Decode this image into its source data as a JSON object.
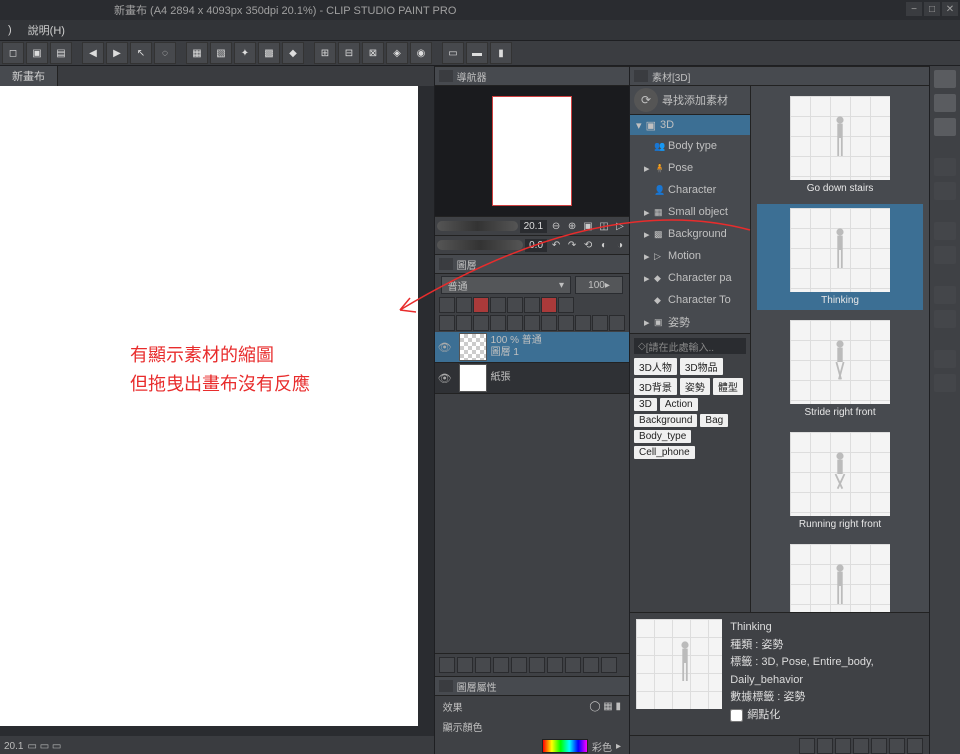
{
  "title": "新畫布 (A4 2894 x 4093px 350dpi 20.1%)  - CLIP STUDIO PAINT PRO",
  "menubar": {
    "item0": ")",
    "item1": "說明(H)"
  },
  "doc_tabs": {
    "0": "新畫布"
  },
  "statusbar": {
    "zoom": "20.1"
  },
  "annotation": {
    "line1": "有顯示素材的縮圖",
    "line2": "但拖曳出畫布沒有反應"
  },
  "navigator": {
    "title": "導航器",
    "zoom": "20.1",
    "angle": "0.0"
  },
  "layers": {
    "title": "圖層",
    "blend_mode": "普通",
    "opacity": "100",
    "items": [
      {
        "percent": "100 % 普通",
        "name": "圖層 1"
      },
      {
        "percent": "",
        "name": "紙張"
      }
    ]
  },
  "layer_props": {
    "title": "圖層屬性",
    "effect": "效果",
    "display_color": "顯示顏色",
    "color_mode": "彩色"
  },
  "materials": {
    "panel_title": "素材[3D]",
    "find_label": "尋找添加素材",
    "tree_root": "3D",
    "tree": [
      "Body type",
      "Pose",
      "Character",
      "Small object",
      "Background",
      "Motion",
      "Character pa",
      "Character To",
      "姿勢"
    ],
    "tag_search_placeholder": "[請在此處輸入..",
    "tags": [
      "3D人物",
      "3D物品",
      "3D背景",
      "姿勢",
      "體型",
      "3D",
      "Action",
      "Background",
      "Bag",
      "Body_type",
      "Cell_phone"
    ],
    "thumbs": [
      "Go down stairs",
      "Thinking",
      "Stride right front",
      "Running right front",
      ""
    ]
  },
  "detail": {
    "name": "Thinking",
    "type_label": "種類 : 姿勢",
    "tags_label": "標籤 : 3D, Pose, Entire_body, Daily_behavior",
    "data_tags": "數據標籤 : 姿勢",
    "gridify": "網點化"
  }
}
